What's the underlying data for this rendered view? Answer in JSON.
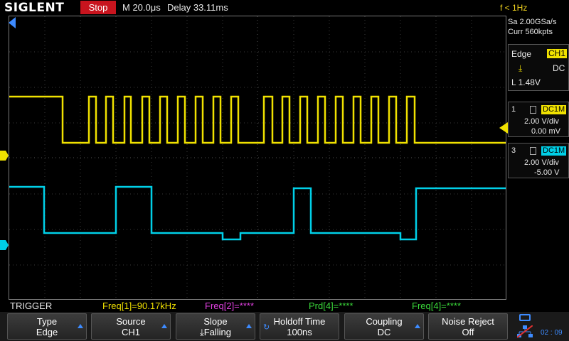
{
  "topbar": {
    "logo": "SIGLENT",
    "run_state": "Stop",
    "timebase": "M 20.0μs",
    "delay": "Delay 33.11ms",
    "trigger_freq": "f < 1Hz"
  },
  "acquisition": {
    "sample_rate": "Sa 2.00GSa/s",
    "memory": "Curr 560kpts"
  },
  "trigger_panel": {
    "type": "Edge",
    "source": "CH1",
    "coupling": "DC",
    "level": "L  1.48V"
  },
  "channels": [
    {
      "num": "1",
      "coupling": "DC1M",
      "vdiv": "2.00 V/div",
      "offset": "0.00 mV",
      "color": "#f0e100"
    },
    {
      "num": "3",
      "coupling": "DC1M",
      "vdiv": "2.00 V/div",
      "offset": "-5.00 V",
      "color": "#00d0e8"
    }
  ],
  "status_row": {
    "menu": "TRIGGER",
    "m1": "Freq[1]=90.17kHz",
    "m2": "Freq[2]=****",
    "m3": "Prd[4]=****",
    "m4": "Freq[4]=****"
  },
  "softkeys": [
    {
      "line1": "Type",
      "line2": "Edge"
    },
    {
      "line1": "Source",
      "line2": "CH1"
    },
    {
      "line1": "Slope",
      "line2": "Falling"
    },
    {
      "line1": "Holdoff Time",
      "line2": "100ns"
    },
    {
      "line1": "Coupling",
      "line2": "DC"
    },
    {
      "line1": "Noise Reject",
      "line2": "Off"
    }
  ],
  "clock": "02 : 09",
  "colors": {
    "ch1": "#f0e100",
    "ch3": "#00d0e8",
    "accent": "#3d8bff",
    "stop": "#c8141e"
  }
}
